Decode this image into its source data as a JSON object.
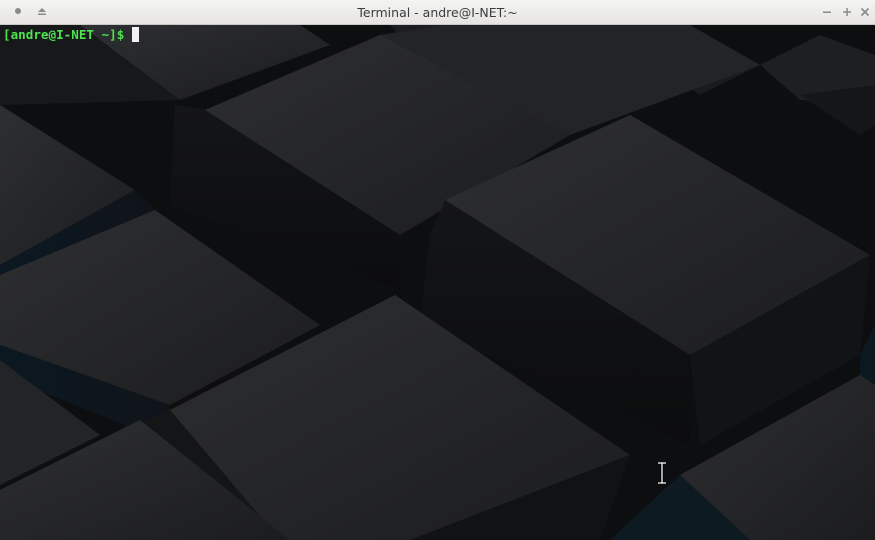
{
  "window": {
    "title": "Terminal - andre@I-NET:~",
    "controls": {
      "menu_icon": "window-menu-icon",
      "shade_icon": "shade-icon",
      "minimize_icon": "minimize-icon",
      "maximize_icon": "maximize-icon",
      "close_icon": "close-icon"
    }
  },
  "terminal": {
    "prompt": "[andre@I-NET ~]$",
    "input": "",
    "prompt_color": "#4ee44e",
    "background_color": "#101113"
  },
  "pointer": {
    "icon": "text-cursor-ibeam-icon"
  }
}
